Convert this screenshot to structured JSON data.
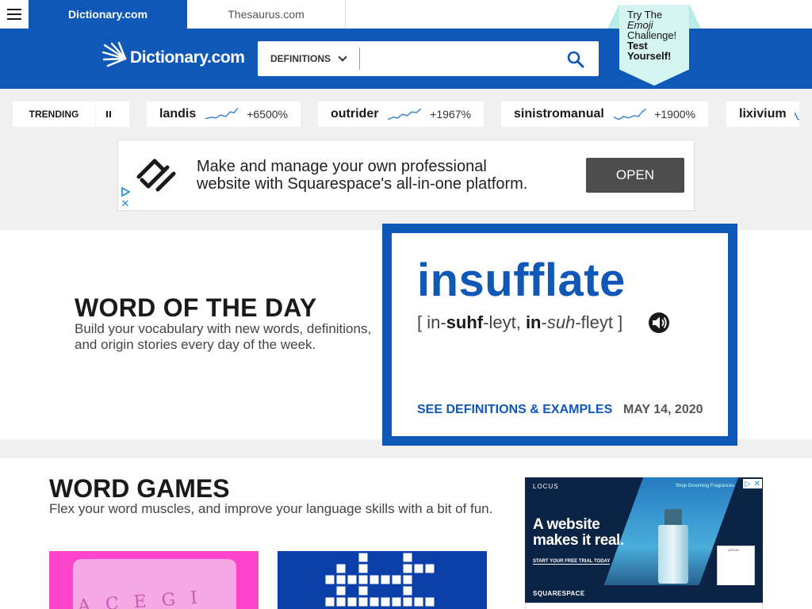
{
  "topbar": {
    "dictionary_tab": "Dictionary.com",
    "thesaurus_tab": "Thesaurus.com"
  },
  "header": {
    "logo_text": "Dictionary.com",
    "search_mode": "DEFINITIONS",
    "search_value": "",
    "emoji_challenge": {
      "line1": "Try The",
      "line2": "Emoji",
      "line3": "Challenge!",
      "line4": "Test",
      "line5": "Yourself!"
    }
  },
  "trending": {
    "label": "TRENDING",
    "items": [
      {
        "word": "landis",
        "change": "+6500%"
      },
      {
        "word": "outrider",
        "change": "+1967%"
      },
      {
        "word": "sinistromanual",
        "change": "+1900%"
      },
      {
        "word": "lixivium",
        "change": ""
      }
    ]
  },
  "ad_banner": {
    "line1": "Make and manage your own professional",
    "line2": "website with Squarespace's all-in-one platform.",
    "button": "OPEN"
  },
  "word_of_the_day": {
    "title": "WORD OF THE DAY",
    "description": "Build your vocabulary with new words, definitions, and origin stories every day of the week.",
    "word": "insufflate",
    "pronunciation": {
      "open": "[ in-",
      "stress1": "suhf",
      "mid1": "-leyt, ",
      "stress2": "in",
      "mid2": "-",
      "ital": "suh",
      "close": "-fleyt ]"
    },
    "link": "SEE DEFINITIONS & EXAMPLES",
    "date": "MAY 14, 2020"
  },
  "word_games": {
    "title": "WORD GAMES",
    "description": "Flex your word muscles, and improve your language skills with a bit of fun.",
    "game1_letters": "A C E G I"
  },
  "side_ad": {
    "brand": "LOCUS",
    "nav": "Shop   Grooming   Fragrances",
    "headline1": "A website",
    "headline2": "makes it real.",
    "cta": "START YOUR FREE TRIAL TODAY",
    "footer": "SQUARESPACE",
    "card_brand": "LOCUS"
  },
  "colors": {
    "brand_blue": "#0f58b7",
    "flag_mint": "#d4f5f0",
    "game_pink": "#ff44cc",
    "game_blue": "#0a3ea8"
  }
}
